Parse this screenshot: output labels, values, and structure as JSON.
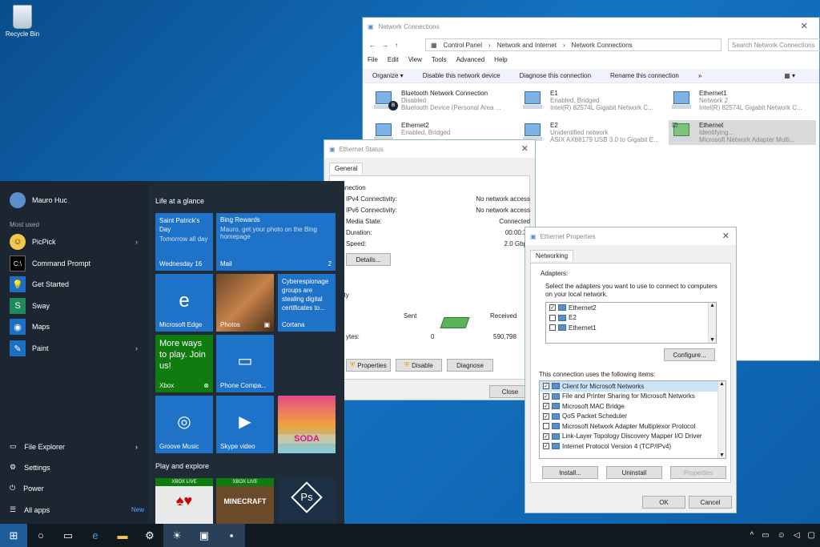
{
  "desktop": {
    "recycle_bin": "Recycle Bin"
  },
  "start_menu": {
    "user_name": "Mauro Huc",
    "most_used_label": "Most used",
    "apps": [
      {
        "label": "PicPick",
        "icon": "picpick-icon",
        "has_submenu": true
      },
      {
        "label": "Command Prompt",
        "icon": "command-prompt-icon",
        "has_submenu": false
      },
      {
        "label": "Get Started",
        "icon": "lightbulb-icon",
        "has_submenu": false
      },
      {
        "label": "Sway",
        "icon": "sway-icon",
        "has_submenu": false
      },
      {
        "label": "Maps",
        "icon": "maps-icon",
        "has_submenu": false
      },
      {
        "label": "Paint",
        "icon": "paint-icon",
        "has_submenu": true
      }
    ],
    "bottom": [
      {
        "label": "File Explorer",
        "icon": "folder-icon"
      },
      {
        "label": "Settings",
        "icon": "gear-icon"
      },
      {
        "label": "Power",
        "icon": "power-icon"
      },
      {
        "label": "All apps",
        "icon": "list-icon"
      }
    ],
    "new_badge": "New",
    "life_at_a_glance": "Life at a glance",
    "play_and_explore": "Play and explore",
    "tiles": {
      "calendar_title": "Saint Patrick's Day",
      "calendar_sub": "Tomorrow all day",
      "calendar_date": "Wednesday 16",
      "mail_title": "Bing Rewards",
      "mail_sub": "Mauro, get your photo on the Bing homepage",
      "mail_label": "Mail",
      "mail_count": "2",
      "edge_label": "Microsoft Edge",
      "photos_label": "Photos",
      "cortana_text": "Cyberespionage groups are stealing digital certificates to...",
      "cortana_label": "Cortana",
      "xbox_text": "More ways to play. Join us!",
      "xbox_label": "Xbox",
      "phone_label": "Phone Compa...",
      "groove_label": "Groove Music",
      "skype_label": "Skype video",
      "candy_label": "SODA",
      "xbox_live": "XBOX LIVE",
      "minecraft": "MINECRAFT",
      "ps": "Ps"
    }
  },
  "network_connections": {
    "title": "Network Connections",
    "breadcrumb": [
      "Control Panel",
      "Network and Internet",
      "Network Connections"
    ],
    "search_placeholder": "Search Network Connections",
    "menu": [
      "File",
      "Edit",
      "View",
      "Tools",
      "Advanced",
      "Help"
    ],
    "commands": [
      "Organize ▾",
      "Disable this network device",
      "Diagnose this connection",
      "Rename this connection",
      "»"
    ],
    "adapters": [
      {
        "name": "Bluetooth Network Connection",
        "status": "Disabled",
        "device": "Bluetooth Device (Personal Area ..."
      },
      {
        "name": "E1",
        "status": "Enabled, Bridged",
        "device": "Intel(R) 82574L Gigabit Network C..."
      },
      {
        "name": "Ethernet1",
        "status": "Network 2",
        "device": "Intel(R) 82574L Gigabit Network C..."
      },
      {
        "name": "Ethernet2",
        "status": "Enabled, Bridged",
        "device": ""
      },
      {
        "name": "E2",
        "status": "Unidentified network",
        "device": "ASIX AX88179 USB 3.0 to Gigabit E..."
      },
      {
        "name": "Ethernet",
        "status": "Identifying...",
        "device": "Microsoft Network Adapter Multi..."
      }
    ]
  },
  "ethernet_status": {
    "title": "Ethernet Status",
    "tab": "General",
    "connection_header": "onnection",
    "rows": [
      {
        "label": "IPv4 Connectivity:",
        "value": "No network access"
      },
      {
        "label": "IPv6 Connectivity:",
        "value": "No network access"
      },
      {
        "label": "Media State:",
        "value": "Connected"
      },
      {
        "label": "Duration:",
        "value": "00:00:34"
      },
      {
        "label": "Speed:",
        "value": "2.0 Gbps"
      }
    ],
    "details_btn": "Details...",
    "activity_header": "ivity",
    "sent": "Sent",
    "received": "Received",
    "bytes_label": "ytes:",
    "bytes_sent": "0",
    "bytes_received": "590,798",
    "properties_btn": "Properties",
    "disable_btn": "Disable",
    "diagnose_btn": "Diagnose",
    "close_btn": "Close"
  },
  "ethernet_properties": {
    "title": "Ethernet Properties",
    "tab": "Networking",
    "adapters_label": "Adapters:",
    "adapters_desc": "Select the adapters you want to use to connect to computers on your local network.",
    "adapters": [
      {
        "name": "Ethernet2",
        "checked": true
      },
      {
        "name": "E2",
        "checked": false
      },
      {
        "name": "Ethernet1",
        "checked": false
      }
    ],
    "configure_btn": "Configure...",
    "items_label": "This connection uses the following items:",
    "items": [
      {
        "name": "Client for Microsoft Networks",
        "checked": true
      },
      {
        "name": "File and Printer Sharing for Microsoft Networks",
        "checked": true
      },
      {
        "name": "Microsoft MAC Bridge",
        "checked": true
      },
      {
        "name": "QoS Packet Scheduler",
        "checked": true
      },
      {
        "name": "Microsoft Network Adapter Multiplexor Protocol",
        "checked": false
      },
      {
        "name": "Link-Layer Topology Discovery Mapper I/O Driver",
        "checked": true
      },
      {
        "name": "Internet Protocol Version 4 (TCP/IPv4)",
        "checked": true
      }
    ],
    "install_btn": "Install...",
    "uninstall_btn": "Uninstall",
    "properties_btn": "Properties",
    "ok_btn": "OK",
    "cancel_btn": "Cancel"
  },
  "taskbar": {
    "icons": [
      "windows-start-icon",
      "cortana-circle-icon",
      "task-view-icon",
      "edge-icon",
      "file-explorer-icon",
      "settings-icon",
      "weather-icon",
      "network-connections-icon",
      "command-prompt-icon"
    ]
  }
}
